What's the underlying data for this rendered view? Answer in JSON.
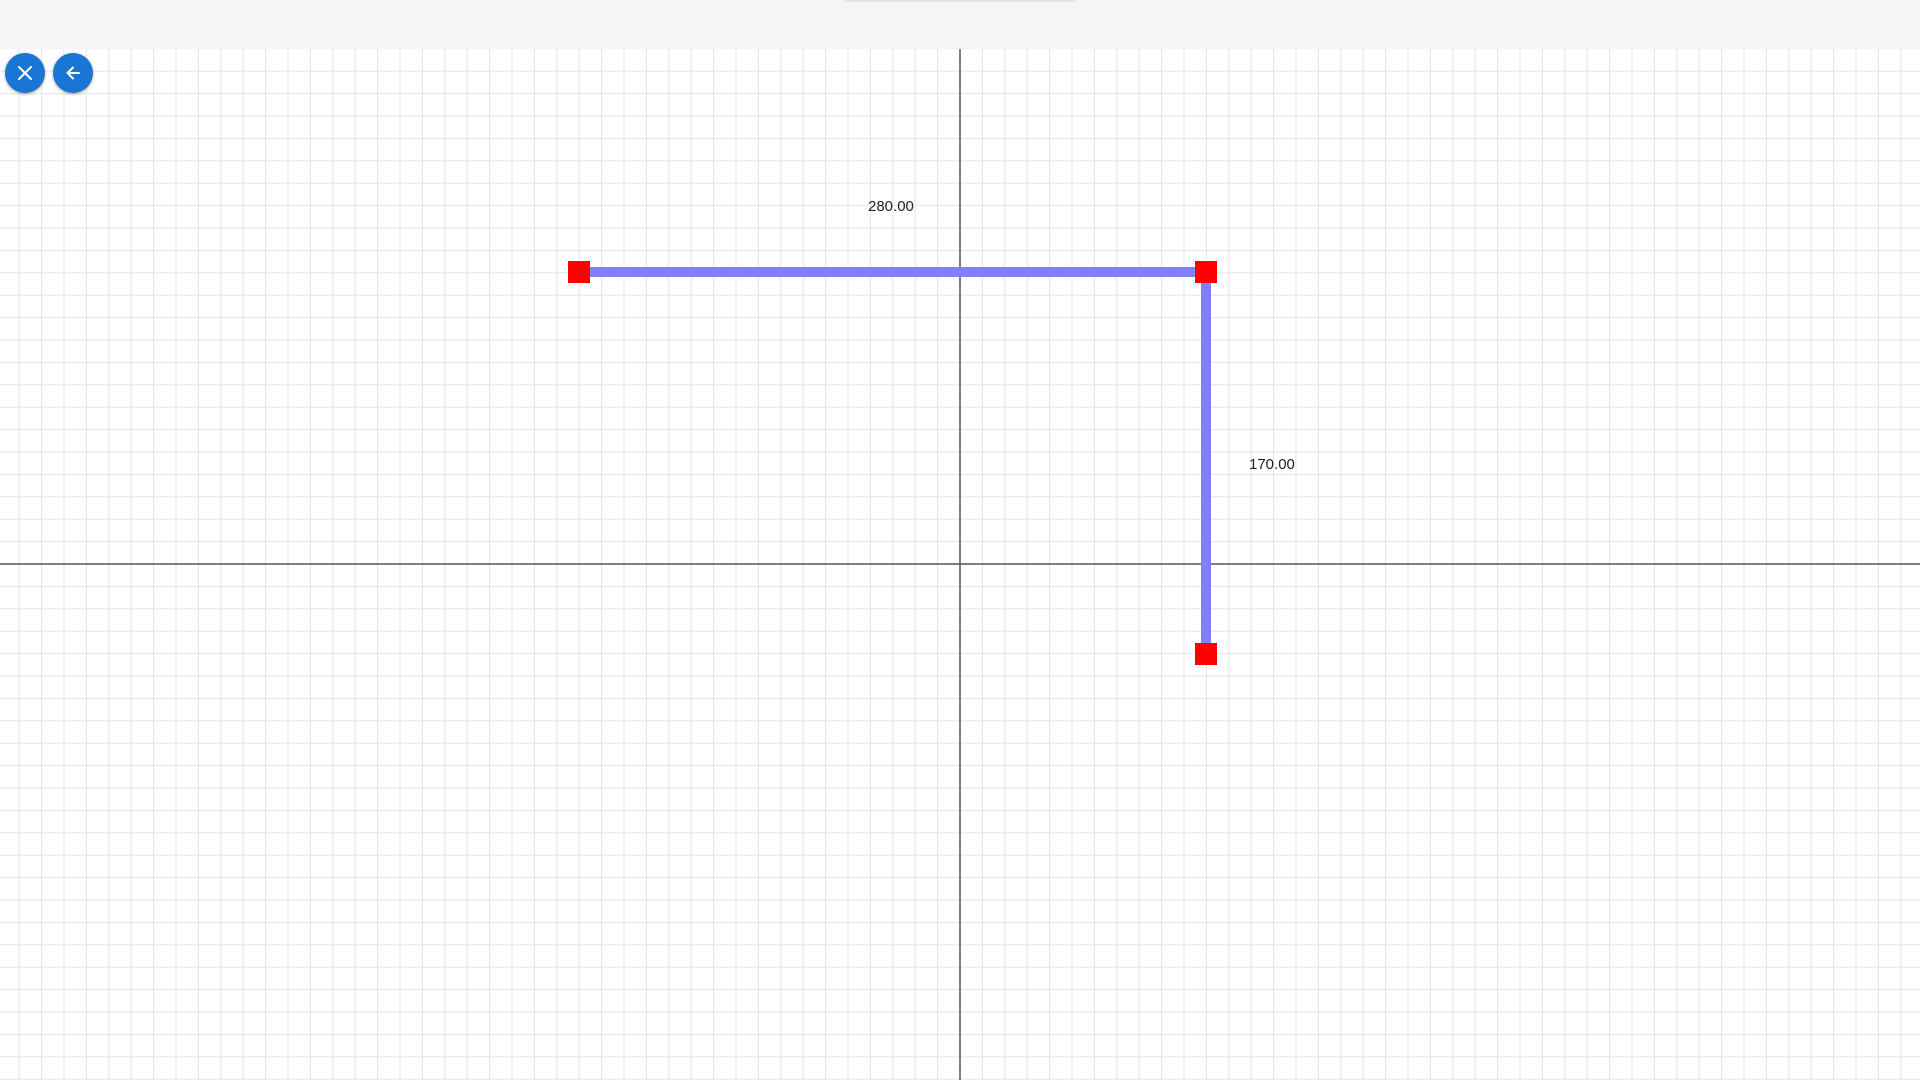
{
  "toolbar": {
    "close_button_icon": "close-icon",
    "back_button_icon": "arrow-left-icon",
    "button_color": "#1976d2"
  },
  "drawing": {
    "segment_color": "#8080f8",
    "handle_color": "#ff0000",
    "segments": [
      {
        "id": "top",
        "length_label": "280.00"
      },
      {
        "id": "right",
        "length_label": "170.00"
      }
    ]
  }
}
